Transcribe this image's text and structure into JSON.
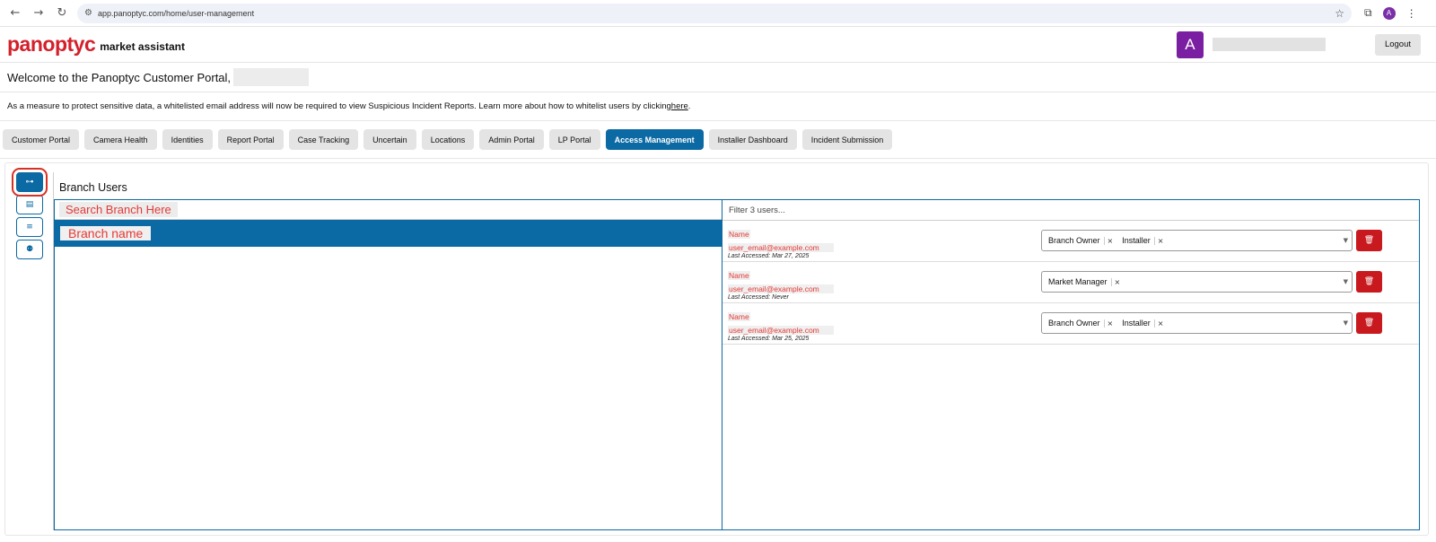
{
  "browser": {
    "url": "app.panoptyc.com/home/user-management",
    "profile_initial": "A"
  },
  "header": {
    "logo": "panoptyc",
    "logo_subtitle": "market assistant",
    "avatar_initial": "A",
    "logout_label": "Logout"
  },
  "welcome": {
    "text": "Welcome to the Panoptyc Customer Portal,"
  },
  "notice": {
    "text": "As a measure to protect sensitive data, a whitelisted email address will now be required to view Suspicious Incident Reports. Learn more about how to whitelist users by clicking ",
    "link_text": "here",
    "suffix": "."
  },
  "tabs": [
    {
      "label": "Customer Portal"
    },
    {
      "label": "Camera Health"
    },
    {
      "label": "Identities"
    },
    {
      "label": "Report Portal"
    },
    {
      "label": "Case Tracking"
    },
    {
      "label": "Uncertain"
    },
    {
      "label": "Locations"
    },
    {
      "label": "Admin Portal"
    },
    {
      "label": "LP Portal"
    },
    {
      "label": "Access Management",
      "active": true
    },
    {
      "label": "Installer Dashboard"
    },
    {
      "label": "Incident Submission"
    }
  ],
  "main": {
    "title": "Branch Users",
    "search_hint": "Search Branch Here",
    "branch_name": "Branch name",
    "users_filter_placeholder": "Filter 3 users...",
    "users": [
      {
        "name": "Name",
        "email": "user_email@example.com",
        "last_accessed": "Last Accessed: Mar 27, 2025",
        "roles": [
          "Branch Owner",
          "Installer"
        ]
      },
      {
        "name": "Name",
        "email": "user_email@example.com",
        "last_accessed": "Last Accessed: Never",
        "roles": [
          "Market Manager"
        ]
      },
      {
        "name": "Name",
        "email": "user_email@example.com",
        "last_accessed": "Last Accessed: Mar 25, 2025",
        "roles": [
          "Branch Owner",
          "Installer"
        ]
      }
    ]
  },
  "icons": {
    "side": [
      "branch-tree-icon",
      "id-card-icon",
      "list-icon",
      "group-icon"
    ]
  },
  "colors": {
    "accent": "#0b69a3",
    "brand": "#d3202a",
    "delete": "#c8191f",
    "avatar": "#7b1fa2"
  }
}
